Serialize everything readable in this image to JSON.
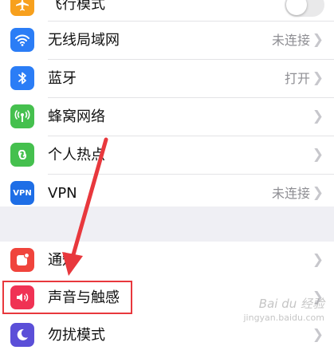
{
  "settings": {
    "airplane": {
      "label": "飞行模式",
      "toggle_on": false
    },
    "wifi": {
      "label": "无线局域网",
      "value": "未连接"
    },
    "bluetooth": {
      "label": "蓝牙",
      "value": "打开"
    },
    "cellular": {
      "label": "蜂窝网络"
    },
    "hotspot": {
      "label": "个人热点"
    },
    "vpn": {
      "label": "VPN",
      "value": "未连接",
      "icon_text": "VPN"
    },
    "notifications": {
      "label": "通知"
    },
    "sounds": {
      "label": "声音与触感"
    },
    "dnd": {
      "label": "勿扰模式"
    }
  },
  "watermark": {
    "text": "Bai du 经验",
    "subtext": "jingyan.baidu.com"
  },
  "colors": {
    "airplane": "#f7a01d",
    "wifi": "#2b7df6",
    "bluetooth": "#2b7df6",
    "cellular": "#45c04e",
    "hotspot": "#45c04e",
    "vpn": "#1e6ee6",
    "notifications": "#f0443c",
    "sounds": "#f03254",
    "dnd": "#5b4fd8",
    "annotation": "#e8383d"
  }
}
